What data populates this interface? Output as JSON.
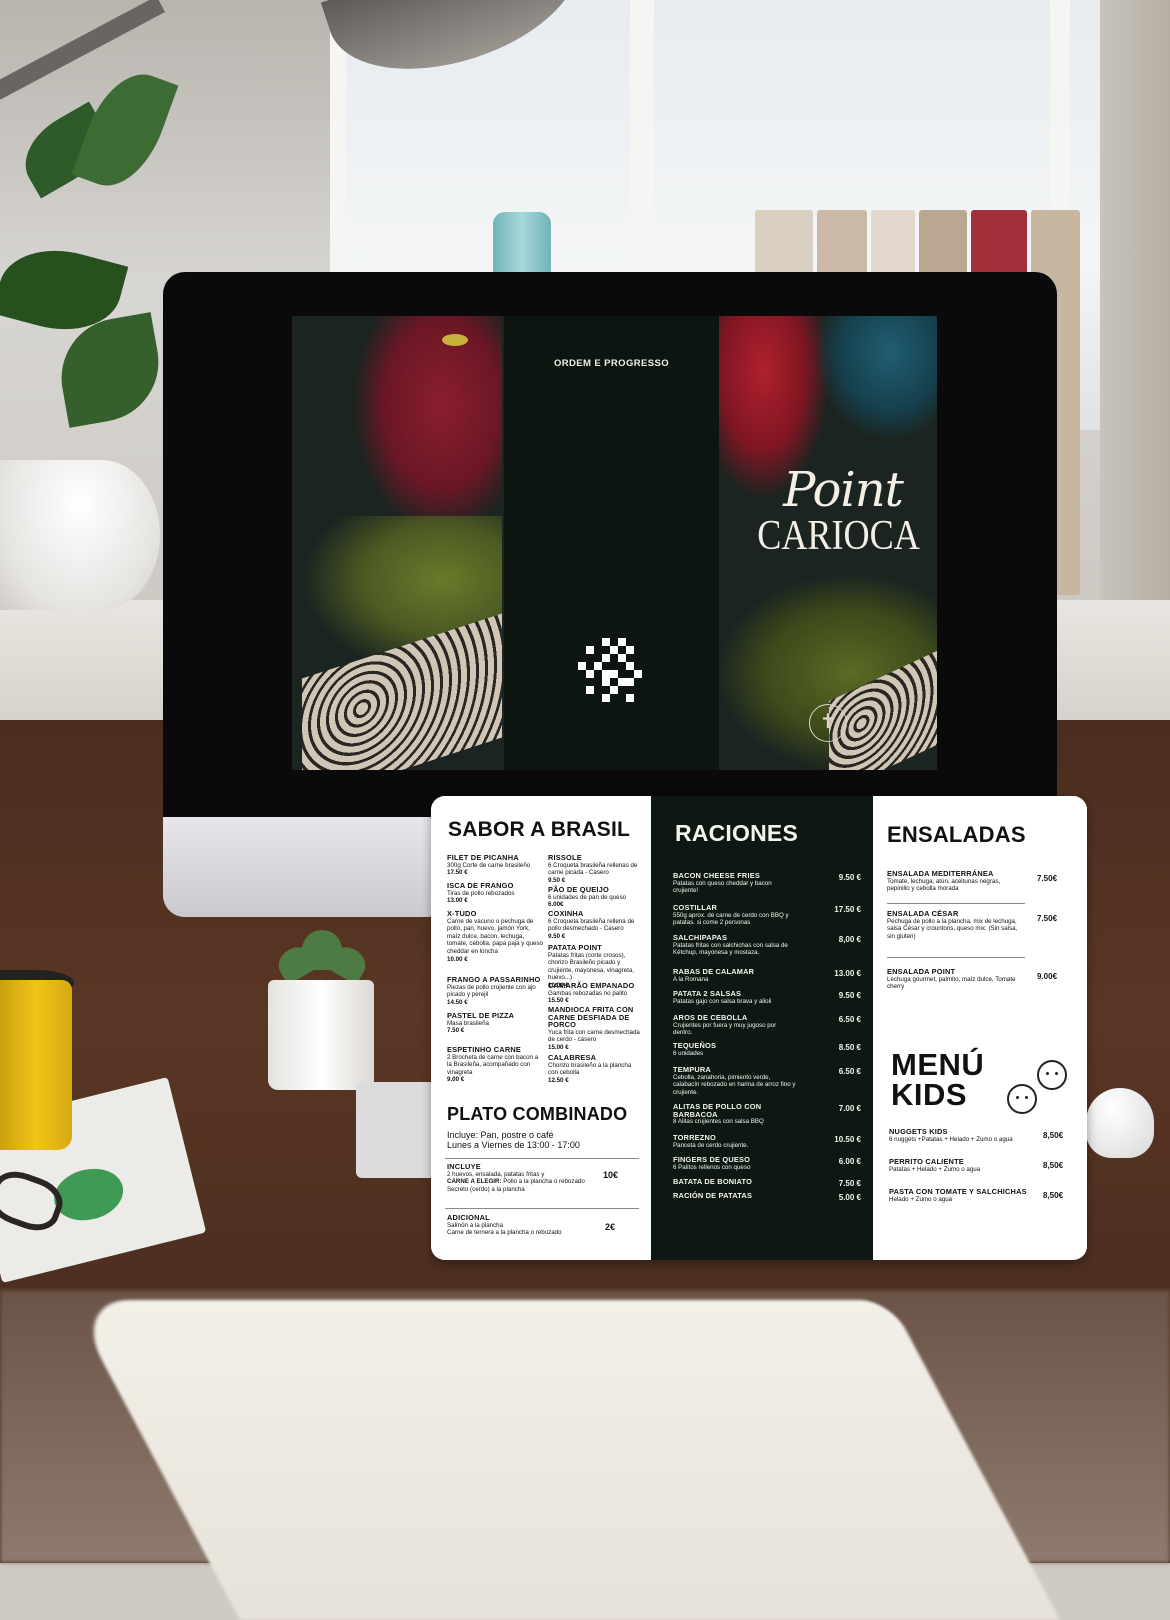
{
  "cover": {
    "back_tagline": "ORDEM E PROGRESSO",
    "brand_script": "Point",
    "brand_caps": "CARIOCA"
  },
  "menu": {
    "sabor": {
      "title": "SABOR A BRASIL",
      "left_items": [
        {
          "name": "FILET DE PICANHA",
          "desc": "300g Corte de carne brasileño",
          "price": "17.50 €"
        },
        {
          "name": "ISCA DE FRANGO",
          "desc": "Tiras de pollo rebozados",
          "price": "13.00 €"
        },
        {
          "name": "X-TUDO",
          "desc": "Carne de vacuno o pechuga de pollo, pan, huevo, jamón York, maíz dulce, bacon, lechuga, tomate, cebolla, papa paja y queso cheddar en loncha",
          "price": "10.00 €"
        },
        {
          "name": "FRANGO A PASSARINHO",
          "desc": "Piezas de pollo crujiente con ajo picado y perejil",
          "price": "14.50 €"
        },
        {
          "name": "PASTEL DE PIZZA",
          "desc": "Masa brasileña",
          "price": "7.50 €"
        },
        {
          "name": "ESPETINHO CARNE",
          "desc": "2 Brocheta de carne con bacon a la Brasileña, acompañado con vinagreta",
          "price": "9.00 €"
        }
      ],
      "right_items": [
        {
          "name": "RISSOLE",
          "desc": "6 Croqueta brasileña rellenas de carne picada - Casero",
          "price": "9.50 €"
        },
        {
          "name": "PÃO DE QUEIJO",
          "desc": "6 unidades de pan de queso",
          "price": "6.00€"
        },
        {
          "name": "COXINHA",
          "desc": "6 Croqueta brasileña rellena de pollo desmechado - Casero",
          "price": "9.50 €"
        },
        {
          "name": "PATATA POINT",
          "desc": "Patatas fritas (corte crosos), chorizo Brasileño picado y crujiente, mayonesa, vinagreta, huevo...)",
          "price": "10.00 €"
        },
        {
          "name": "CAMARÃO EMPANADO",
          "desc": "Gambas rebozadas no palito",
          "price": "15.50 €"
        },
        {
          "name": "MANDIOCA FRITA CON CARNE DESFIADA DE PORCO",
          "desc": "Yuca frita con carne desmechada de cerdo - casero",
          "price": "15.00 €"
        },
        {
          "name": "CALABRESA",
          "desc": "Chorizo brasileño a la plancha con cebolla",
          "price": "12.50 €"
        }
      ]
    },
    "combinado": {
      "title": "PLATO COMBINADO",
      "subtitle1": "Incluye:  Pan, postre o café",
      "subtitle2": "Lunes a Viernes de 13:00 - 17:00",
      "incluye_label": "INCLUYE",
      "incluye_line1": "2 huevos, ensalada, patatas fritas y",
      "incluye_line2_bold": "CARNE A ELEGIR:",
      "incluye_line2": " Pollo a la plancha o rebozado",
      "incluye_line3": "Secreto (cerdo) a la plancha",
      "incluye_price": "10€",
      "adicional_label": "ADICIONAL",
      "adicional_line1": "Salmón a la plancha",
      "adicional_line2": "Carne de ternera a la plancha o rebozado",
      "adicional_price": "2€"
    },
    "raciones": {
      "title": "RACIONES",
      "items": [
        {
          "name": "BACON CHEESE FRIES",
          "desc": "Patatas con queso cheddar y bacon crujiente!",
          "price": "9.50 €"
        },
        {
          "name": "COSTILLAR",
          "desc": "550g aprox. de carne de cerdo con BBQ y patatas. si come 2 personas",
          "price": "17.50 €"
        },
        {
          "name": "SALCHIPAPAS",
          "desc": "Patatas fritas con salchichas con salsa de Kétchup, mayonesa y mostaza.",
          "price": "8,00 €"
        },
        {
          "name": "RABAS DE CALAMAR",
          "desc": "A la Romana",
          "price": "13.00 €"
        },
        {
          "name": "PATATA 2 SALSAS",
          "desc": "Patatas gajo con salsa brava y alioli",
          "price": "9.50 €"
        },
        {
          "name": "AROS DE CEBOLLA",
          "desc": "Crujientes por fuera y muy jugoso por dentro.",
          "price": "6.50 €"
        },
        {
          "name": "TEQUEÑOS",
          "desc": "6 unidades",
          "price": "8.50 €"
        },
        {
          "name": "TEMPURA",
          "desc": "Cebolla, zanahoria, pimiento verde, calabacín rebozado en harina de arroz fino y crujiente.",
          "price": "6.50 €"
        },
        {
          "name": "ALITAS DE POLLO CON BARBACOA",
          "desc": "8 Alitas crujientes con salsa BBQ",
          "price": "7.00 €"
        },
        {
          "name": "TORREZNO",
          "desc": "Panceta de cerdo crujiente.",
          "price": "10.50 €"
        },
        {
          "name": "FINGERS DE QUESO",
          "desc": "6 Palitos rellenos con queso",
          "price": "6.00 €"
        },
        {
          "name": "BATATA DE BONIATO",
          "desc": "",
          "price": "7.50 €"
        },
        {
          "name": "RACIÓN DE PATATAS",
          "desc": "",
          "price": "5.00 €"
        }
      ]
    },
    "ensaladas": {
      "title": "ENSALADAS",
      "items": [
        {
          "name": "ENSALADA MEDITERRÁNEA",
          "desc": "Tomate, lechuga, atún, aceitunas negras, pepinillo y cebolla morada",
          "price": "7.50€"
        },
        {
          "name": "ENSALADA CÉSAR",
          "desc": "Pechuga de pollo a la plancha, mix de lechuga, salsa César y crountons, queso mix. (Sin salsa, sin gluten)",
          "price": "7.50€"
        },
        {
          "name": "ENSALADA POINT",
          "desc": "Lechuga gourmet, palmito, maíz dulce, Tomate cherry",
          "price": "9.00€"
        }
      ]
    },
    "kids": {
      "title_line1": "MENÚ",
      "title_line2": "KIDS",
      "items": [
        {
          "name": "NUGGETS KIDS",
          "desc": "6 nuggets +Patatas + Helado + Zumo o agua",
          "price": "8,50€"
        },
        {
          "name": "PERRITO CALIENTE",
          "desc": "Patatas + Helado + Zumo o agua",
          "price": "8,50€"
        },
        {
          "name": "PASTA CON TOMATE Y SALCHICHAS",
          "desc": "Helado + Zumo o agua",
          "price": "8,50€"
        }
      ]
    }
  },
  "colors": {
    "menu_dark": "#0d1812",
    "cover_dark": "#0c150f",
    "desk": "#4a2d1f",
    "mug": "#f0c418"
  },
  "icons": [
    "christ-redeemer-icon",
    "qr-code",
    "kids-faces-icon"
  ]
}
